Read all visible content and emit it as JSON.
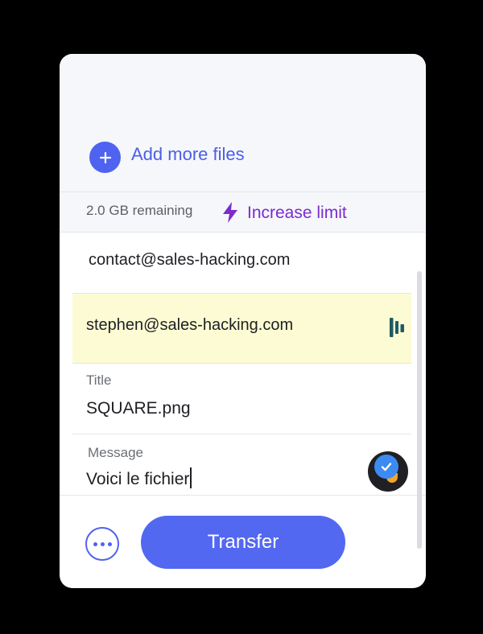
{
  "upload": {
    "add_more_label": "Add more files"
  },
  "quota": {
    "remaining_text": "2.0 GB remaining",
    "increase_label": "Increase limit"
  },
  "recipients": {
    "email_1": "contact@sales-hacking.com",
    "email_2": "stephen@sales-hacking.com"
  },
  "title_field": {
    "label": "Title",
    "value": "SQUARE.png"
  },
  "message_field": {
    "label": "Message",
    "value": "Voici le fichier"
  },
  "actions": {
    "transfer_label": "Transfer"
  },
  "colors": {
    "accent": "#4f63f0",
    "upgrade": "#7b2bd0",
    "highlight": "#fcfbd3"
  },
  "icons": {
    "add": "plus-icon",
    "upgrade": "lightning-bolt-icon",
    "autofill": "dashlane-icon",
    "grammar": "grammarly-check-icon",
    "more": "more-dots-icon"
  }
}
